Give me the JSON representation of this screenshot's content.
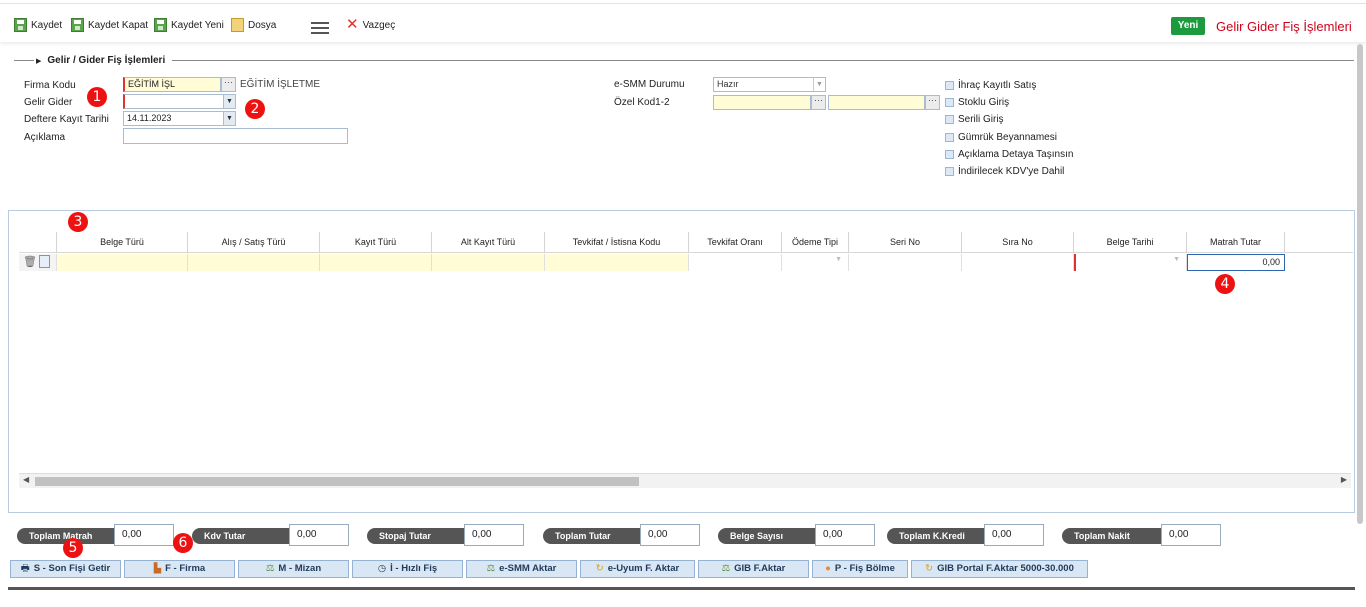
{
  "toolbar": {
    "save_label": "Kaydet",
    "save_close_label": "Kaydet Kapat",
    "save_new_label": "Kaydet Yeni",
    "file_label": "Dosya",
    "cancel_label": "Vazgeç"
  },
  "header": {
    "mode_badge": "Yeni",
    "page_title": "Gelir Gider Fiş İşlemleri"
  },
  "section": {
    "title": "Gelir / Gider Fiş İşlemleri"
  },
  "form": {
    "firma_kodu_label": "Firma Kodu",
    "firma_kodu_value": "EĞİTİM İŞL",
    "firma_name": "EĞİTİM İŞLETME",
    "gelir_gider_label": "Gelir Gider",
    "gelir_gider_value": "",
    "defter_tarihi_label": "Deftere Kayıt Tarihi",
    "defter_tarihi_value": "14.11.2023",
    "aciklama_label": "Açıklama",
    "aciklama_value": "",
    "esmm_label": "e-SMM Durumu",
    "esmm_value": "Hazır",
    "ozel_kod_label": "Özel Kod1-2",
    "ozel_kod1_value": "",
    "ozel_kod2_value": "",
    "ellipsis": "···",
    "dropdown_arrow": "▼"
  },
  "checkboxes": [
    {
      "label": "İhraç Kayıtlı Satış",
      "checked": false
    },
    {
      "label": "Stoklu Giriş",
      "checked": false
    },
    {
      "label": "Serili Giriş",
      "checked": false
    },
    {
      "label": "Gümrük Beyannamesi",
      "checked": false
    },
    {
      "label": "Açıklama Detaya Taşınsın",
      "checked": false
    },
    {
      "label": "İndirilecek KDV'ye Dahil",
      "checked": false
    }
  ],
  "grid": {
    "columns": [
      "Belge Türü",
      "Alış / Satış Türü",
      "Kayıt Türü",
      "Alt Kayıt Türü",
      "Tevkifat / İstisna Kodu",
      "Tevkifat Oranı",
      "Ödeme Tipi",
      "Seri No",
      "Sıra No",
      "Belge Tarihi",
      "Matrah Tutar"
    ],
    "row": {
      "matrah_tutar": "0,00"
    }
  },
  "totals": [
    {
      "label": "Toplam Matrah",
      "value": "0,00"
    },
    {
      "label": "Kdv Tutar",
      "value": "0,00"
    },
    {
      "label": "Stopaj Tutar",
      "value": "0,00"
    },
    {
      "label": "Toplam Tutar",
      "value": "0,00"
    },
    {
      "label": "Belge Sayısı",
      "value": "0,00"
    },
    {
      "label": "Toplam K.Kredi",
      "value": "0,00"
    },
    {
      "label": "Toplam Nakit",
      "value": "0,00"
    }
  ],
  "bottom_buttons": [
    {
      "label": "S - Son Fişi Getir",
      "icon": "printer-icon",
      "glyph": "🖶"
    },
    {
      "label": "F - Firma",
      "icon": "factory-icon",
      "glyph": "▙"
    },
    {
      "label": "M - Mizan",
      "icon": "scale-icon",
      "glyph": "⚖"
    },
    {
      "label": "İ - Hızlı Fiş",
      "icon": "clock-icon",
      "glyph": "◷"
    },
    {
      "label": "e-SMM Aktar",
      "icon": "scale-icon",
      "glyph": "⚖"
    },
    {
      "label": "e-Uyum F. Aktar",
      "icon": "refresh-icon",
      "glyph": "↻"
    },
    {
      "label": "GIB F.Aktar",
      "icon": "scale-icon",
      "glyph": "⚖"
    },
    {
      "label": "P - Fiş Bölme",
      "icon": "dot-icon",
      "glyph": "●"
    },
    {
      "label": "GIB Portal F.Aktar 5000-30.000",
      "icon": "refresh-icon",
      "glyph": "↻"
    }
  ],
  "markers": [
    "1",
    "2",
    "3",
    "4",
    "5",
    "6"
  ],
  "colors": {
    "accent_red": "#d0021b",
    "badge_green": "#1d9a3e",
    "input_yellow": "#fffcd6",
    "button_blue": "#d9e6f4",
    "total_label_bg": "#555555"
  }
}
